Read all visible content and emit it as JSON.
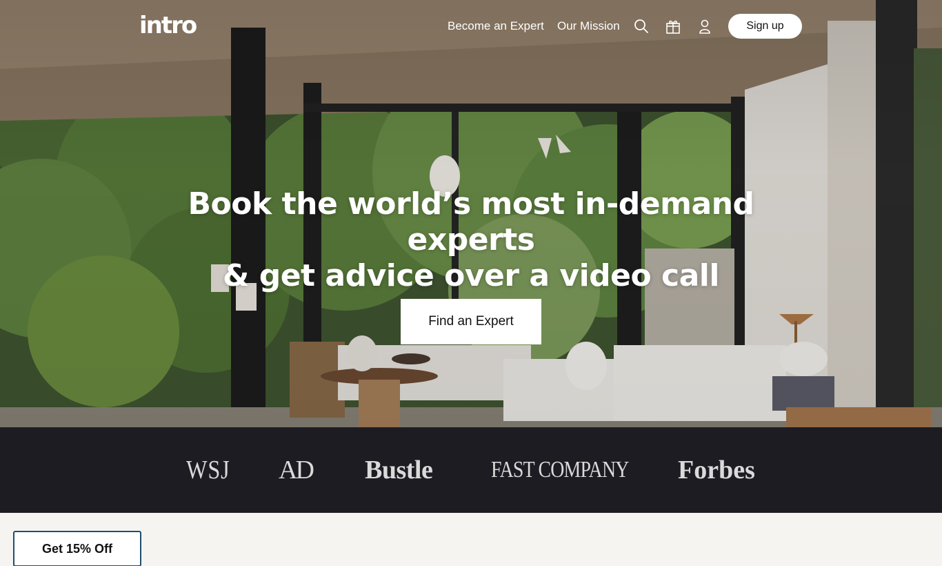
{
  "nav": {
    "logo": "intro",
    "links": [
      "Become an Expert",
      "Our Mission"
    ],
    "icons": [
      "search-icon",
      "gift-icon",
      "user-icon"
    ],
    "signup_label": "Sign up"
  },
  "hero": {
    "headline_line1": "Book the world’s most in-demand experts",
    "headline_line2": "& get advice over a video call",
    "cta_label": "Find an Expert"
  },
  "press": {
    "logos": [
      "WSJ",
      "AD",
      "Bustle",
      "FAST COMPANY",
      "Forbes"
    ]
  },
  "promo": {
    "label": "Get 15% Off"
  },
  "colors": {
    "press_bg": "#1d1c22",
    "page_bg": "#f5f4f1",
    "promo_border": "#1f4e6e"
  }
}
